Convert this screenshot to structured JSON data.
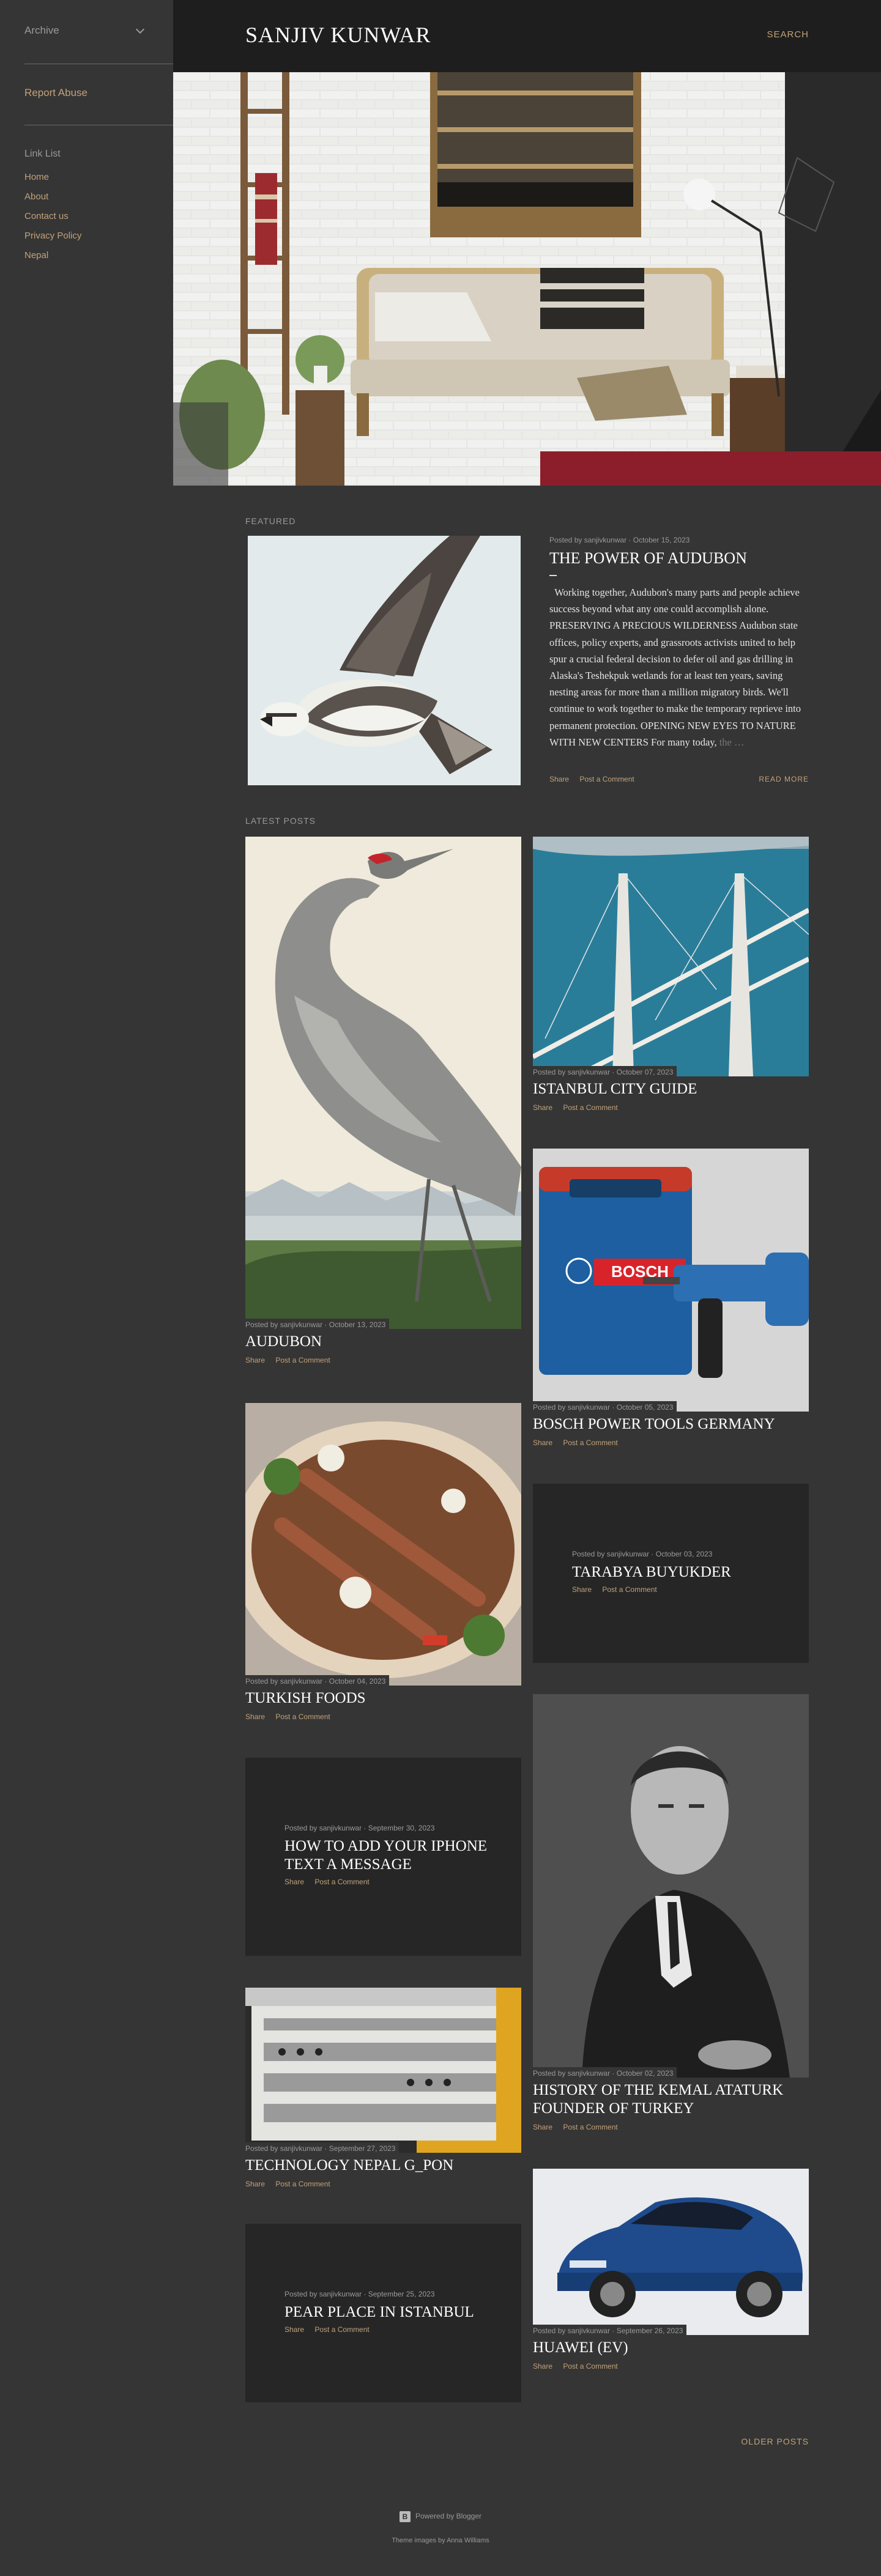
{
  "sidebar": {
    "archive_label": "Archive",
    "report_abuse": "Report Abuse",
    "link_list_title": "Link List",
    "links": [
      "Home",
      "About",
      "Contact us",
      "Privacy Policy",
      "Nepal"
    ]
  },
  "header": {
    "title": "SANJIV KUNWAR",
    "search_label": "SEARCH"
  },
  "featured": {
    "section_label": "FEATURED",
    "meta": "Posted by sanjivkunwar · October 15, 2023",
    "title": "THE POWER OF AUDUBON",
    "body": "Working together, Audubon's many parts and people achieve success beyond what any one could accomplish alone. PRESERVING A PRECIOUS WILDERNESS Audubon state offices, policy experts, and grassroots activists united to help spur a crucial federal decision to defer oil and gas drilling in Alaska's Teshekpuk wetlands for at least ten years, saving nesting areas for more than a million migratory birds. We'll continue to work together to make the temporary reprieve into permanent protection. OPENING NEW EYES TO NATURE WITH NEW CENTERS For many today,",
    "body_fade": "the …",
    "share": "Share",
    "comment": "Post a Comment",
    "read_more": "READ MORE"
  },
  "latest": {
    "section_label": "LATEST POSTS",
    "share": "Share",
    "comment": "Post a Comment",
    "posts": [
      {
        "meta": "Posted by sanjivkunwar · October 13, 2023",
        "title": "AUDUBON"
      },
      {
        "meta": "Posted by sanjivkunwar · October 07, 2023",
        "title": "ISTANBUL CITY GUIDE"
      },
      {
        "meta": "Posted by sanjivkunwar · October 05, 2023",
        "title": "BOSCH POWER TOOLS GERMANY"
      },
      {
        "meta": "Posted by sanjivkunwar · October 04, 2023",
        "title": "TURKISH FOODS"
      },
      {
        "meta": "Posted by sanjivkunwar · October 03, 2023",
        "title": "TARABYA BUYUKDER"
      },
      {
        "meta": "Posted by sanjivkunwar · September 30, 2023",
        "title": "HOW TO ADD YOUR IPHONE TEXT A MESSAGE"
      },
      {
        "meta": "Posted by sanjivkunwar · October 02, 2023",
        "title": "HISTORY OF THE KEMAL ATATURK FOUNDER OF TURKEY"
      },
      {
        "meta": "Posted by sanjivkunwar · September 27, 2023",
        "title": "TECHNOLOGY NEPAL G_PON"
      },
      {
        "meta": "Posted by sanjivkunwar · September 26, 2023",
        "title": "HUAWEI (EV)"
      },
      {
        "meta": "Posted by sanjivkunwar · September 25, 2023",
        "title": "PEAR PLACE IN ISTANBUL"
      }
    ]
  },
  "images": {
    "bosch_case_label": "BOSCH"
  },
  "footer": {
    "older_posts": "OLDER POSTS",
    "powered_by": "Powered by Blogger",
    "blogger_glyph": "B",
    "credits": "Theme images by Anna Williams"
  },
  "colors": {
    "background": "#353535",
    "header": "#1e1e1e",
    "accent": "#c2a27a",
    "muted": "#9a9a9a",
    "card": "#262626"
  }
}
